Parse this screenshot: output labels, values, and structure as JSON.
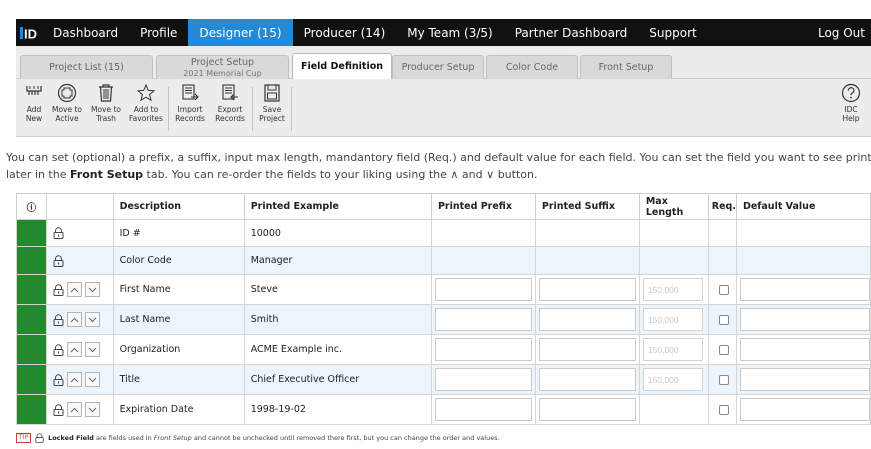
{
  "nav": {
    "logo": "ID",
    "items": [
      "Dashboard",
      "Profile",
      "Designer (15)",
      "Producer (14)",
      "My Team (3/5)",
      "Partner Dashboard",
      "Support"
    ],
    "active_index": 2,
    "logout": "Log Out"
  },
  "tabs": [
    {
      "label": "Project List (15)",
      "sub": ""
    },
    {
      "label": "Project Setup",
      "sub": "2021 Memorial Cup"
    },
    {
      "label": "Field Definition",
      "sub": ""
    },
    {
      "label": "Producer Setup",
      "sub": ""
    },
    {
      "label": "Color Code",
      "sub": ""
    },
    {
      "label": "Front Setup",
      "sub": ""
    }
  ],
  "active_tab": "Field Definition",
  "toolbar": {
    "add_new": [
      "Add",
      "New"
    ],
    "move_active": [
      "Move to",
      "Active"
    ],
    "move_trash": [
      "Move to",
      "Trash"
    ],
    "add_favorites": [
      "Add to",
      "Favorites"
    ],
    "import_records": [
      "Import",
      "Records"
    ],
    "export_records": [
      "Export",
      "Records"
    ],
    "save_project": [
      "Save",
      "Project"
    ],
    "help": [
      "IDC",
      "Help"
    ]
  },
  "info": {
    "line1": "You can set (optional) a prefix, a suffix, input max length, mandantory field (Req.) and default value for each field. You can set the field you want to see printed on the card",
    "line2_a": "later in the ",
    "line2_b": "Front Setup",
    "line2_c": " tab. You can re-order the fields to your liking using the ",
    "line2_up": "∧",
    "line2_and": " and ",
    "line2_down": "∨",
    "line2_d": " button."
  },
  "table": {
    "headers": {
      "info": "ⓘ",
      "description": "Description",
      "printed_example": "Printed Example",
      "printed_prefix": "Printed Prefix",
      "printed_suffix": "Printed Suffix",
      "max_length": "Max Length",
      "req": "Req.",
      "default_value": "Default Value"
    },
    "max_placeholder": "150,000",
    "rows": [
      {
        "description": "ID #",
        "example": "10000"
      },
      {
        "description": "Color Code",
        "example": "Manager"
      },
      {
        "description": "First Name",
        "example": "Steve"
      },
      {
        "description": "Last Name",
        "example": "Smith"
      },
      {
        "description": "Organization",
        "example": "ACME Example inc."
      },
      {
        "description": "Title",
        "example": "Chief Executive Officer"
      },
      {
        "description": "Expiration Date",
        "example": "1998-19-02"
      }
    ]
  },
  "legend": {
    "tip": "TIP",
    "bold": "Locked Field",
    "text_a": " are fields used in ",
    "italic": "Front Setup",
    "text_b": " and cannot be unchecked until removed there first, but you can change the order and values."
  },
  "colors": {
    "nav_bg": "#111111",
    "nav_active": "#2489d6",
    "row_green": "#228a2c",
    "row_alt": "#edf5fc"
  }
}
